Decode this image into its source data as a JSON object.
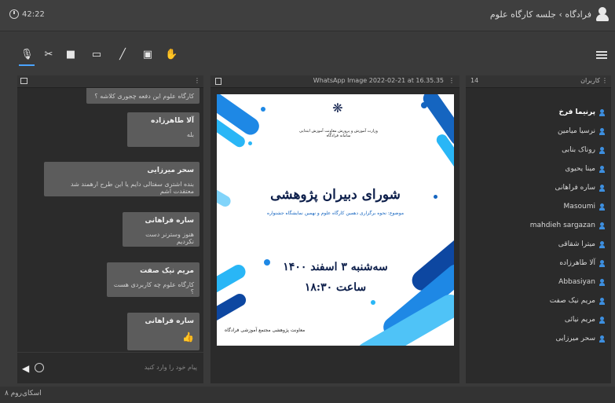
{
  "topbar": {
    "time": "42:22",
    "title": "فرادگاه › جلسه کارگاه علوم"
  },
  "toolbar": {
    "tools": [
      "microphone-icon",
      "hand-icon",
      "camera-icon",
      "monitor-icon",
      "pen-icon",
      "presentation-icon",
      "hand-raise-icon"
    ]
  },
  "chat": {
    "messages": [
      {
        "name": "",
        "text": "کارگاه علوم این دفعه چجوری کلاشه ؟"
      },
      {
        "name": "آلا طاهرزاده",
        "text": "بله"
      },
      {
        "name": "سحر میرزایی",
        "text": "بنده اشتری سفتالی دایم یا این طرح ارهمند شد معتقدت اشم"
      },
      {
        "name": "ساره فراهانی",
        "text": "هنوز وسترنر دست نکردیم"
      },
      {
        "name": "مریم نیک صفت",
        "text": "کارگاه علوم چه کاربردی هست ؟"
      },
      {
        "name": "ساره فراهانی",
        "text": "👍"
      }
    ],
    "input_placeholder": "پیام خود را وارد کنید"
  },
  "presentation": {
    "header": "WhatsApp Image 2022-02-21 at 16.35.35",
    "org": "وزارت آموزش و پرورش معاونت آموزش ابتدایی سامانه فرادگاه",
    "title": "شورای دبیران پژوهشی",
    "subtitle": "موضوع: نحوه برگزاری دهمین کارگاه علوم و نهمین نمایشگاه جشنواره",
    "date": "سه‌شنبه ۳ اسفند ۱۴۰۰",
    "time": "ساعت ۱۸:۳۰",
    "footer": "معاونت پژوهشی مجتمع آموزشی فرادگاه"
  },
  "users": {
    "header_label": "کاربران",
    "count": "14",
    "list": [
      "پرنیما فرخ",
      "نرسیا میامین",
      "روناک بنابی",
      "مینا یحیوی",
      "ساره فراهانی",
      "Masoumi",
      "mahdieh sargazan",
      "میترا شقاقی",
      "آلا طاهرزاده",
      "Abbasiyan",
      "مریم نیک صفت",
      "مریم نیائی",
      "سحر میرزایی"
    ]
  },
  "status": {
    "text": "اسکای‌روم ۸"
  },
  "colors": {
    "accent": "#4aa3ff",
    "user_icon": "#3d8fe0",
    "panel_bg": "#2b2b2b"
  }
}
